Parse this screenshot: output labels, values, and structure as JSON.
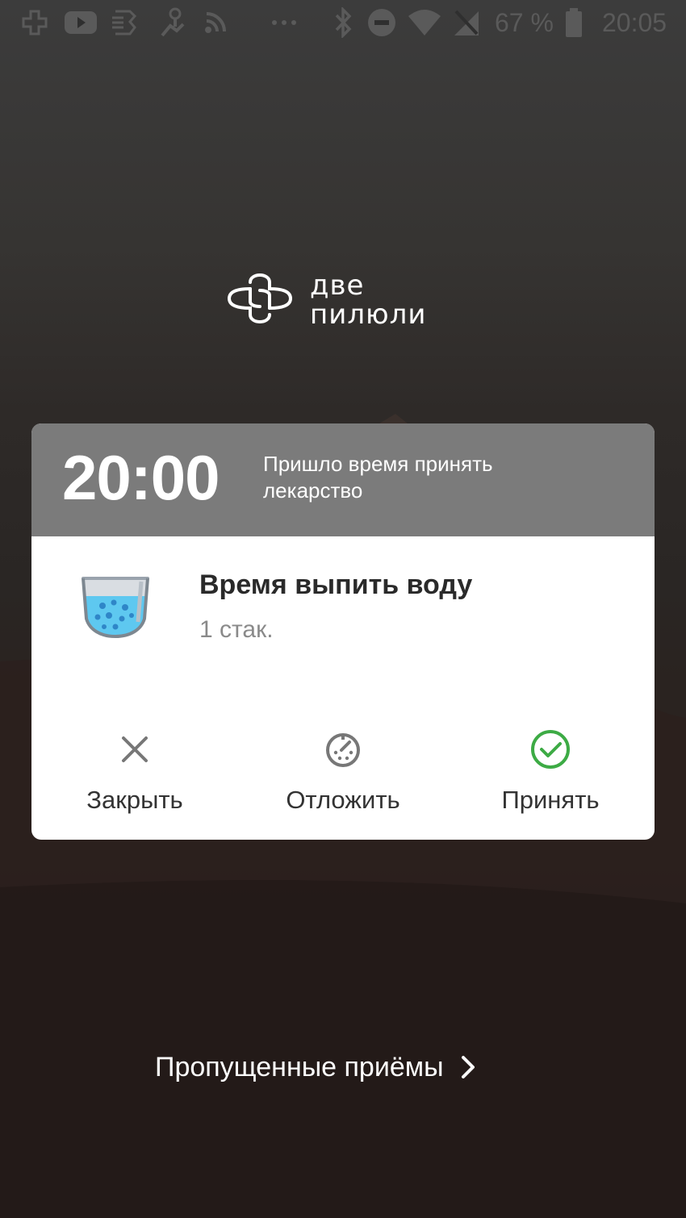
{
  "status_bar": {
    "battery_percent": "67 %",
    "time": "20:05",
    "left_icons": [
      "app-logo-icon",
      "youtube-icon",
      "notification-app-icon",
      "location-icon",
      "rss-icon",
      "more-icon"
    ],
    "right_icons": [
      "bluetooth-icon",
      "do-not-disturb-icon",
      "wifi-icon",
      "no-signal-icon",
      "battery-icon"
    ]
  },
  "logo": {
    "line1": "две",
    "line2": "пилюли"
  },
  "reminder": {
    "time": "20:00",
    "message": "Пришло время принять лекарство",
    "header_color": "#7b7b7b",
    "medication_name": "Время выпить воду",
    "dose": "1 стак.",
    "icon": "water-glass-icon"
  },
  "actions": {
    "close_label": "Закрыть",
    "snooze_label": "Отложить",
    "accept_label": "Принять",
    "accept_color": "#3dab45"
  },
  "missed": {
    "label": "Пропущенные приёмы"
  }
}
